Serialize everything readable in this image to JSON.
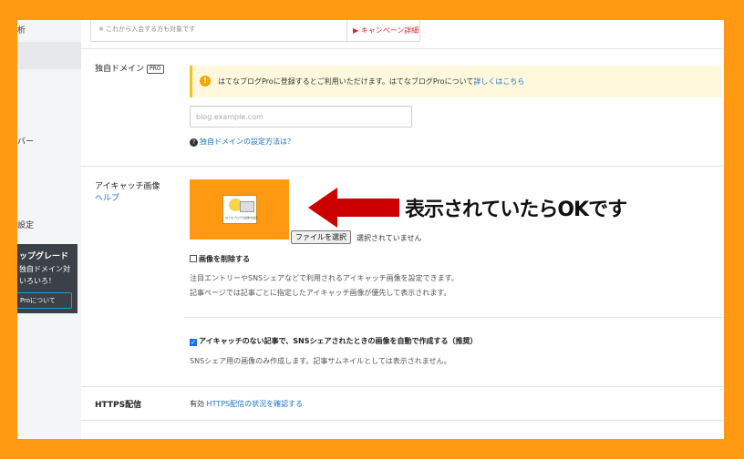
{
  "colors": {
    "background": "#ff9912",
    "link": "#1a73c8",
    "campaign": "#e0262b",
    "arrow": "#cc0000"
  },
  "sidebar": {
    "items": [
      {
        "label": "析"
      },
      {
        "label": "バー"
      },
      {
        "label": "設定"
      }
    ],
    "upgrade": {
      "title": "ップグレード",
      "line1": "独自ドメイン対",
      "line2": "いろいろ！",
      "button": "Proについて"
    }
  },
  "top": {
    "note": "※ これから入会する方も対象です",
    "campaign_link": "▶ キャンペーン詳細"
  },
  "domain": {
    "label": "独自ドメイン",
    "badge": "PRO",
    "alert_text": "はてなブログProに登録するとご利用いただけます。はてなブログProについて",
    "alert_link": "詳しくはこちら",
    "placeholder": "blog.example.com",
    "help_link": "独自ドメインの設定方法は？"
  },
  "eyecatch": {
    "label": "アイキャッチ画像",
    "help": "ヘルプ",
    "thumbnail_caption": "はてなブログの画像を設定",
    "annotation": "表示されていたらOKです",
    "file_button": "ファイルを選択",
    "file_status": "選択されていません",
    "delete_label": "画像を削除する",
    "delete_checked": false,
    "desc1": "注目エントリーやSNSシェアなどで利用されるアイキャッチ画像を設定できます。",
    "desc2": "記事ページでは記事ごとに指定したアイキャッチ画像が優先して表示されます。",
    "auto_label": "アイキャッチのない記事で、SNSシェアされたときの画像を自動で作成する（推奨）",
    "auto_checked": true,
    "auto_desc": "SNSシェア用の画像のみ作成します。記事サムネイルとしては表示されません。"
  },
  "https": {
    "label": "HTTPS配信",
    "status": "有効",
    "link": "HTTPS配信の状況を確認する"
  }
}
